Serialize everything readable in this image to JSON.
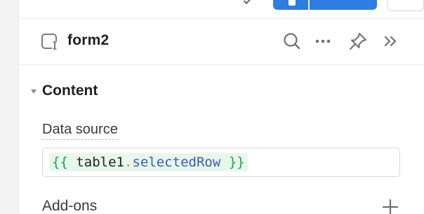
{
  "panel": {
    "title": "form2",
    "icons": {
      "component": "form-icon",
      "search": "search-icon",
      "more": "more-icon",
      "pin": "pin-icon",
      "collapse": "double-chevron-right-icon"
    }
  },
  "content": {
    "section_title": "Content",
    "data_source": {
      "label": "Data source",
      "tokens": {
        "open": "{{",
        "ident": "table1",
        "dot": ".",
        "prop": "selectedRow",
        "close": "}}"
      }
    },
    "addons_label": "Add-ons"
  },
  "colors": {
    "accent": "#2f7de1",
    "brace": "#18a34a",
    "prop": "#3d5ab8",
    "dot": "#e08a1e",
    "chip_bg": "#e7f7ec"
  }
}
